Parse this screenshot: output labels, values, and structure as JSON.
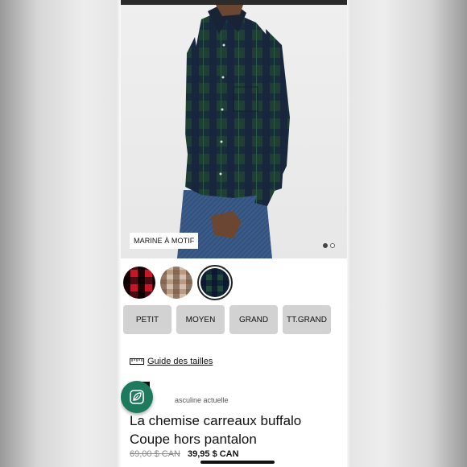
{
  "product_image": {
    "color_tag": "MARINE À MOTIF",
    "carousel": {
      "count": 2,
      "active_index": 0
    }
  },
  "swatches": [
    {
      "name": "red-black-plaid-swatch",
      "selected": false,
      "color": "#c5162a"
    },
    {
      "name": "beige-plaid-swatch",
      "selected": false,
      "color": "#b99b82"
    },
    {
      "name": "navy-green-plaid-swatch",
      "selected": true,
      "color": "#214a3a"
    }
  ],
  "sizes": [
    "PETIT",
    "MOYEN",
    "GRAND",
    "TT.GRAND"
  ],
  "size_guide": {
    "label": "Guide des tailles",
    "icon": "ruler-icon"
  },
  "floating_button": {
    "icon": "leaf-badge-icon",
    "color": "#1e7a5c"
  },
  "product": {
    "category": "asculine actuelle",
    "title": "La chemise carreaux buffalo Coupe hors pantalon",
    "old_price": "69,00 $ CAN",
    "new_price": "39,95 $ CAN"
  }
}
